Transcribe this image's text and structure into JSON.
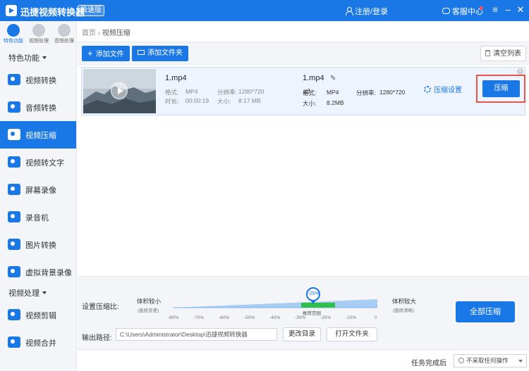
{
  "app": {
    "title": "迅捷视频转换器",
    "badge": "极速版",
    "login_label": "注册/登录",
    "service_label": "客服中心",
    "window_controls": [
      "menu-icon",
      "minimize-icon",
      "close-icon"
    ]
  },
  "sidebar": {
    "top_categories": [
      {
        "label": "特色功能",
        "icon": "star-icon",
        "active": true
      },
      {
        "label": "视频处理",
        "icon": "film-icon",
        "active": false
      },
      {
        "label": "音频处理",
        "icon": "music-icon",
        "active": false
      }
    ],
    "section_feature": "特色功能",
    "items": [
      {
        "label": "视频转换",
        "icon": "video-convert-icon"
      },
      {
        "label": "音频转换",
        "icon": "audio-convert-icon"
      },
      {
        "label": "视频压缩",
        "icon": "video-compress-icon",
        "active": true
      },
      {
        "label": "视频转文字",
        "icon": "video-to-text-icon"
      },
      {
        "label": "屏幕录像",
        "icon": "screen-record-icon"
      },
      {
        "label": "录音机",
        "icon": "recorder-icon"
      },
      {
        "label": "图片转换",
        "icon": "image-convert-icon"
      },
      {
        "label": "虚拟背景录像",
        "icon": "virtual-bg-icon"
      }
    ],
    "section_video": "视频处理",
    "video_items": [
      {
        "label": "视频剪辑",
        "icon": "video-edit-icon"
      },
      {
        "label": "视频合并",
        "icon": "video-merge-icon"
      }
    ]
  },
  "breadcrumb": {
    "home": "首页",
    "current": "视频压缩"
  },
  "toolbar": {
    "add_file": "添加文件",
    "add_folder": "添加文件夹",
    "clear_list": "清空列表"
  },
  "file": {
    "source": {
      "name": "1.mp4",
      "format_label": "格式:",
      "format": "MP4",
      "resolution_label": "分辨率:",
      "resolution": "1280*720",
      "duration_label": "时长:",
      "duration": "00:00:19",
      "size_label": "大小:",
      "size": "8.17 MB"
    },
    "output": {
      "name": "1.mp4",
      "format_label": "格式:",
      "format": "MP4",
      "resolution_label": "分辨率:",
      "resolution": "1280*720",
      "size_label": "大小:",
      "size": "8.2MB"
    },
    "settings_label": "压缩设置",
    "compress_button": "压缩"
  },
  "compression": {
    "ratio_label": "设置压缩比:",
    "left_label": "体积较小",
    "left_sub": "(画质变差)",
    "right_label": "体积较大",
    "right_sub": "(画质清晰)",
    "ticks": [
      "-80%",
      "-70%",
      "-60%",
      "-50%",
      "-40%",
      "-30%",
      "-20%",
      "-10%",
      "0"
    ],
    "current_value": "-25%",
    "current_percent": -25,
    "recommend_label": "推荐范围",
    "output_label": "输出路径:",
    "output_path": "C:\\Users\\Administrator\\Desktop\\迅捷视频转换器",
    "change_dir": "更改目录",
    "open_folder": "打开文件夹",
    "all_compress": "全部压缩"
  },
  "footer": {
    "after_label": "任务完成后",
    "after_option": "不采取任何操作"
  },
  "colors": {
    "accent": "#1a78e6",
    "highlight": "#e8534a",
    "recommend": "#2fbf4a"
  }
}
